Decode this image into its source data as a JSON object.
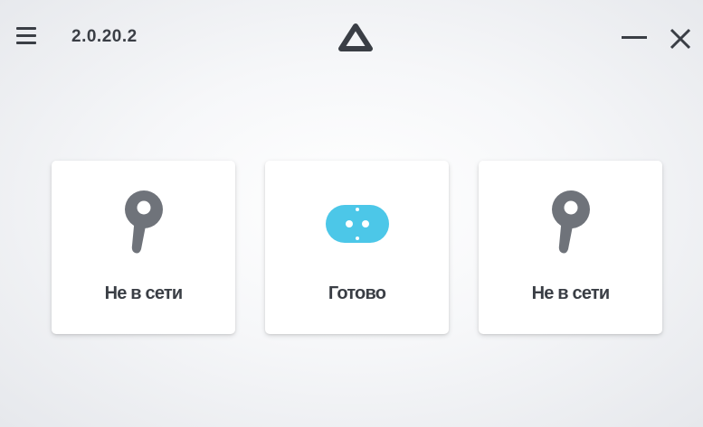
{
  "titlebar": {
    "version": "2.0.20.2",
    "menu_icon": "hamburger-menu-icon",
    "logo_icon": "vive-triangle-logo-icon",
    "minimize_icon": "minimize-icon",
    "close_icon": "close-icon"
  },
  "devices": [
    {
      "name": "controller-left",
      "icon": "controller-icon",
      "status": "Не в сети",
      "icon_color": "#6f737a"
    },
    {
      "name": "headset",
      "icon": "headset-icon",
      "status": "Готово",
      "icon_color": "#4cc7e8"
    },
    {
      "name": "controller-right",
      "icon": "controller-icon",
      "status": "Не в сети",
      "icon_color": "#6f737a"
    }
  ],
  "colors": {
    "text": "#3a3e45",
    "offline_icon": "#6f737a",
    "ready_icon": "#4cc7e8"
  }
}
